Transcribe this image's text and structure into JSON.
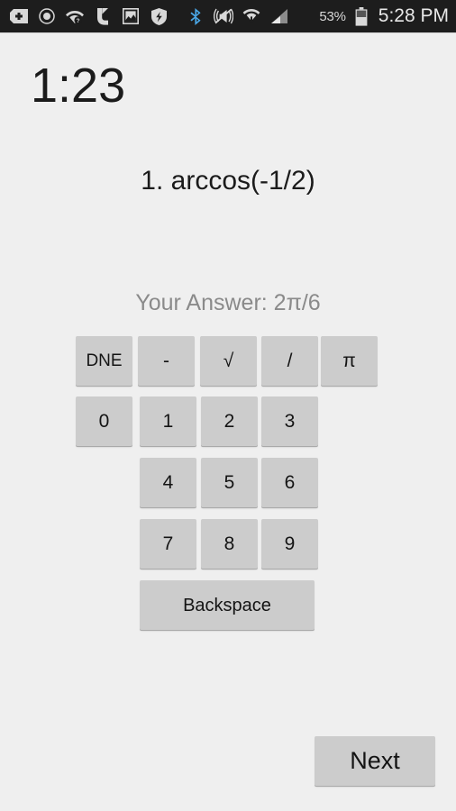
{
  "status_bar": {
    "background_color": "#1d1d1d",
    "icons": [
      "sd-card-plus-icon",
      "recording-circle-icon",
      "wifi-question-icon",
      "tango-call-icon",
      "screenshot-image-icon",
      "security-shield-icon",
      "bluetooth-icon",
      "vibrate-mute-icon",
      "wifi-transfer-icon",
      "cellular-signal-icon"
    ],
    "battery_percent": "53%",
    "battery_icon": "battery-icon",
    "clock": "5:28 PM"
  },
  "screen": {
    "background_color": "#efefef",
    "timer": "1:23",
    "question": "1. arccos(-1/2)",
    "answer_label": "Your Answer: 2π/6",
    "answer_text_color": "#8a8a8a"
  },
  "keypad": {
    "button_color": "#cccccc",
    "rows": [
      {
        "keys": [
          {
            "label": "DNE",
            "name": "key-dne"
          },
          {
            "label": "-",
            "name": "key-minus"
          },
          {
            "label": "√",
            "name": "key-sqrt"
          },
          {
            "label": "/",
            "name": "key-divide"
          },
          {
            "label": "π",
            "name": "key-pi"
          }
        ]
      },
      {
        "keys": [
          {
            "label": "0",
            "name": "key-0"
          },
          {
            "label": "1",
            "name": "key-1"
          },
          {
            "label": "2",
            "name": "key-2"
          },
          {
            "label": "3",
            "name": "key-3"
          }
        ]
      },
      {
        "keys": [
          {
            "label": "4",
            "name": "key-4"
          },
          {
            "label": "5",
            "name": "key-5"
          },
          {
            "label": "6",
            "name": "key-6"
          }
        ]
      },
      {
        "keys": [
          {
            "label": "7",
            "name": "key-7"
          },
          {
            "label": "8",
            "name": "key-8"
          },
          {
            "label": "9",
            "name": "key-9"
          }
        ]
      }
    ],
    "backspace_label": "Backspace"
  },
  "footer": {
    "next_label": "Next"
  }
}
